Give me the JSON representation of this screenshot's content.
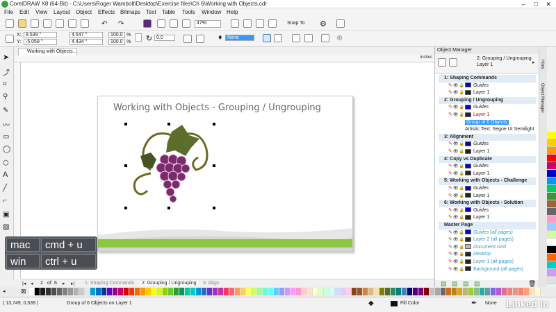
{
  "window": {
    "title": "CorelDRAW X8 (64-Bit) - C:\\Users\\Roger Wambolt\\Desktop\\Exercise files\\Ch 6\\Working with Objects.cdr",
    "min": "–",
    "max": "□",
    "close": "✕"
  },
  "menu": [
    "File",
    "Edit",
    "View",
    "Layout",
    "Object",
    "Effects",
    "Bitmaps",
    "Text",
    "Table",
    "Tools",
    "Window",
    "Help"
  ],
  "toolbar": {
    "zoom": "47%",
    "snap": "Snap To"
  },
  "propbar": {
    "x_label": "X:",
    "x": "8.539 \"",
    "y_label": "Y:",
    "y": "-5.058 \"",
    "w": "4.547 \"",
    "h": "4.434 \"",
    "sx": "100.0",
    "sy": "100.0",
    "pct": "%",
    "angle": "0.0",
    "outline": "None"
  },
  "doc_tab": "Working with Objects...",
  "ruler_unit": "inches",
  "page_title": "Working with Objects  - Grouping / Ungrouping",
  "shortcut": {
    "mac_label": "mac",
    "mac_keys": "cmd + u",
    "win_label": "win",
    "win_keys": "ctrl + u"
  },
  "pagenav": {
    "current": "2",
    "of": "of",
    "total": "6",
    "tabs": [
      "1: Shaping Commands",
      "2: Grouping / Ungrouping",
      "3: Align"
    ]
  },
  "status": {
    "coords": "( 13,749, 0,539 )",
    "selection": "Group of 6 Objects on Layer 1",
    "fill": "Fill Color",
    "outline": "None"
  },
  "docker": {
    "title": "Object Manager",
    "current_path": "2: Grouping / Ungrouping",
    "current_layer": "Layer 1",
    "side_tabs": [
      "Hints",
      "Object Manager"
    ],
    "rows": [
      {
        "type": "page",
        "text": "1: Shaping Commands"
      },
      {
        "type": "layer",
        "text": "Guides",
        "color": "#0000cc",
        "italic": true
      },
      {
        "type": "layer",
        "text": "Layer 1",
        "color": "#222222"
      },
      {
        "type": "page",
        "text": "2: Grouping / Ungrouping"
      },
      {
        "type": "layer",
        "text": "Guides",
        "color": "#0000cc",
        "italic": true
      },
      {
        "type": "layer",
        "text": "Layer 1",
        "color": "#222222",
        "red": true
      },
      {
        "type": "obj",
        "text": "Group of 6 Objects",
        "selected": true
      },
      {
        "type": "obj",
        "text": "Artistic Text: Segoe UI Semilight"
      },
      {
        "type": "page",
        "text": "3: Alignment"
      },
      {
        "type": "layer",
        "text": "Guides",
        "color": "#0000cc",
        "italic": true
      },
      {
        "type": "layer",
        "text": "Layer 1",
        "color": "#222222"
      },
      {
        "type": "page",
        "text": "4: Copy vs Duplicate"
      },
      {
        "type": "layer",
        "text": "Guides",
        "color": "#0000cc",
        "italic": true
      },
      {
        "type": "layer",
        "text": "Layer 1",
        "color": "#222222"
      },
      {
        "type": "page",
        "text": "5: Working with Objects - Challenge"
      },
      {
        "type": "layer",
        "text": "Guides",
        "color": "#0000cc",
        "italic": true
      },
      {
        "type": "layer",
        "text": "Layer 1",
        "color": "#222222"
      },
      {
        "type": "page",
        "text": "6: Working with Objects - Solution"
      },
      {
        "type": "layer",
        "text": "Guides",
        "color": "#0000cc",
        "italic": true
      },
      {
        "type": "layer",
        "text": "Layer 1",
        "color": "#222222"
      },
      {
        "type": "page",
        "text": "Master Page"
      },
      {
        "type": "layer",
        "text": "Guides (all pages)",
        "color": "#0000cc",
        "italic": true,
        "blue": true
      },
      {
        "type": "layer",
        "text": "Layer 2 (all pages)",
        "color": "#222222",
        "blue": true
      },
      {
        "type": "layer",
        "text": "Document Grid",
        "color": "#bbbbbb",
        "italic": true,
        "blue": true
      },
      {
        "type": "layer",
        "text": "Desktop",
        "color": "#222222",
        "italic": true,
        "blue": true
      },
      {
        "type": "layer",
        "text": "Layer 1 (all pages)",
        "color": "#222222",
        "blue": true
      },
      {
        "type": "layer",
        "text": "Background (all pages)",
        "color": "#222222",
        "blue": true
      }
    ]
  },
  "watermark": "Linked in",
  "palette_colors": [
    "#ffffff",
    "#000000",
    "#1a1a1a",
    "#333333",
    "#4d4d4d",
    "#666666",
    "#808080",
    "#999999",
    "#b3b3b3",
    "#cccccc",
    "#e6e6e6",
    "#00a0e0",
    "#0070c0",
    "#003399",
    "#6600cc",
    "#990099",
    "#cc0066",
    "#e00000",
    "#ff3300",
    "#ff6600",
    "#ff9900",
    "#ffcc00",
    "#ffff00",
    "#ccff00",
    "#99cc00",
    "#66cc33",
    "#339933",
    "#009966",
    "#00cc99",
    "#00cccc",
    "#0099cc",
    "#3366cc",
    "#6633cc",
    "#9933cc",
    "#cc3399",
    "#ff3366",
    "#ff6666",
    "#ff9966",
    "#ffcc66",
    "#ffff66",
    "#ccff66",
    "#99ff99",
    "#66ffcc",
    "#66ffff",
    "#66ccff",
    "#9999ff",
    "#cc99ff",
    "#ff99ff",
    "#ff99cc",
    "#ffcccc",
    "#ffe0cc",
    "#ffffcc",
    "#e0ffcc",
    "#ccffe0",
    "#ccffff",
    "#cce0ff",
    "#e0ccff",
    "#ffccf0",
    "#8b4513",
    "#a0522d",
    "#cd853f",
    "#deb887",
    "#f5deb3",
    "#808000",
    "#556b2f",
    "#2e8b57",
    "#008080",
    "#4682b4",
    "#000080",
    "#4b0082",
    "#800080",
    "#800000",
    "#c0c0c0",
    "#a9a9a9",
    "#696969",
    "#d2691e",
    "#b8860b",
    "#daa520",
    "#bdb76b",
    "#9acd32",
    "#8fbc8f",
    "#20b2aa",
    "#5f9ea0",
    "#7b68ee",
    "#ba55d3",
    "#db7093",
    "#f08080",
    "#e9967a",
    "#fa8072",
    "#ffa07a",
    "#ffe4b5",
    "#fffacd"
  ],
  "side_colors": [
    "#ffff00",
    "#ffcc00",
    "#ff9900",
    "#ff0000",
    "#cc0066",
    "#0000cc",
    "#0099ff",
    "#00cc66",
    "#339933",
    "#996633",
    "#666666",
    "#ff99cc",
    "#99ccff",
    "#ccff99",
    "#ffffff",
    "#000000",
    "#ff6600",
    "#00cccc",
    "#cc99ff",
    "#e0e0e0"
  ]
}
